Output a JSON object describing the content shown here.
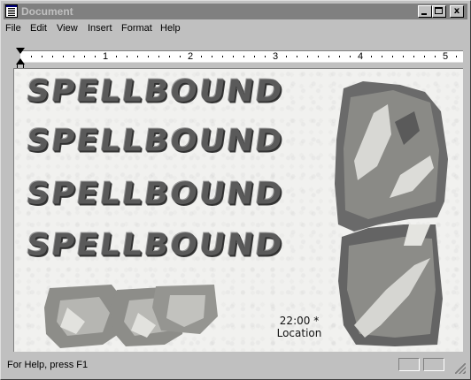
{
  "window": {
    "title": "Document",
    "buttons": {
      "minimize": "",
      "maximize": "",
      "close": "x"
    }
  },
  "menu": {
    "items": [
      {
        "label": "File"
      },
      {
        "label": "Edit"
      },
      {
        "label": "View"
      },
      {
        "label": "Insert"
      },
      {
        "label": "Format"
      },
      {
        "label": "Help"
      }
    ]
  },
  "ruler": {
    "numbers": [
      "1",
      "2",
      "3",
      "4",
      "5"
    ]
  },
  "document": {
    "title_rows": [
      "SPELLBOUND",
      "SPELLBOUND",
      "SPELLBOUND",
      "SPELLBOUND"
    ],
    "event_time": "22:00 *",
    "event_location": "Location"
  },
  "status": {
    "help_text": "For Help, press F1"
  },
  "colors": {
    "titlebar_inactive": "#808080",
    "face": "#c0c0c0",
    "paper": "#f1f1ef"
  }
}
